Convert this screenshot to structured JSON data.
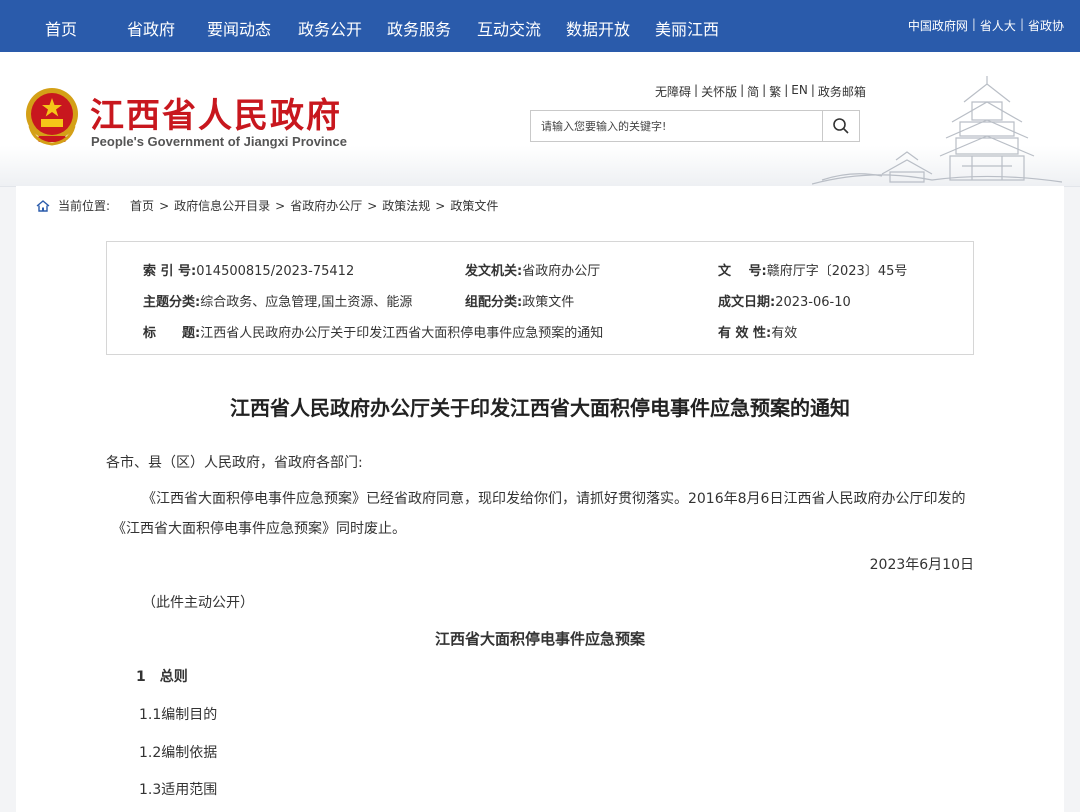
{
  "topnav": {
    "items": [
      "首页",
      "省政府",
      "要闻动态",
      "政务公开",
      "政务服务",
      "互动交流",
      "数据开放",
      "美丽江西"
    ],
    "right_links": [
      "中国政府网",
      "省人大",
      "省政协"
    ],
    "separator": "|"
  },
  "header": {
    "title": "江西省人民政府",
    "subtitle": "People's Government of Jiangxi Province",
    "util_links": [
      "无障碍",
      "关怀版",
      "简",
      "繁",
      "EN",
      "政务邮箱"
    ],
    "search_placeholder": "请输入您要输入的关键字!"
  },
  "breadcrumb": {
    "label": "当前位置:",
    "items": [
      "首页",
      "政府信息公开目录",
      "省政府办公厅",
      "政策法规",
      "政策文件"
    ]
  },
  "meta": {
    "index_key": "索 引 号:",
    "index_val": "014500815/2023-75412",
    "issuer_key": "发文机关:",
    "issuer_val": "省政府办公厅",
    "docno_key": "文　 号:",
    "docno_val": "赣府厅字〔2023〕45号",
    "topic_key": "主题分类:",
    "topic_val": "综合政务、应急管理,国土资源、能源",
    "category_key": "组配分类:",
    "category_val": "政策文件",
    "date_key": "成文日期:",
    "date_val": "2023-06-10",
    "title_key": "标　　题:",
    "title_val": "江西省人民政府办公厅关于印发江西省大面积停电事件应急预案的通知",
    "validity_key": "有 效 性:",
    "validity_val": "有效"
  },
  "document": {
    "title": "江西省人民政府办公厅关于印发江西省大面积停电事件应急预案的通知",
    "salutation": "各市、县（区）人民政府，省政府各部门:",
    "body_line1": "《江西省大面积停电事件应急预案》已经省政府同意，现印发给你们，请抓好贯彻落实。2016年8月6日江西省人民政府办公厅印发的",
    "body_line2": "《江西省大面积停电事件应急预案》同时废止。",
    "date": "2023年6月10日",
    "note": "（此件主动公开）",
    "plan_title": "江西省大面积停电事件应急预案",
    "section1": "1　总则",
    "sub1": "1.1编制目的",
    "sub2": "1.2编制依据",
    "sub3": "1.3适用范围"
  },
  "colors": {
    "nav_bg": "#2a5bab",
    "title_red": "#c8171e"
  }
}
